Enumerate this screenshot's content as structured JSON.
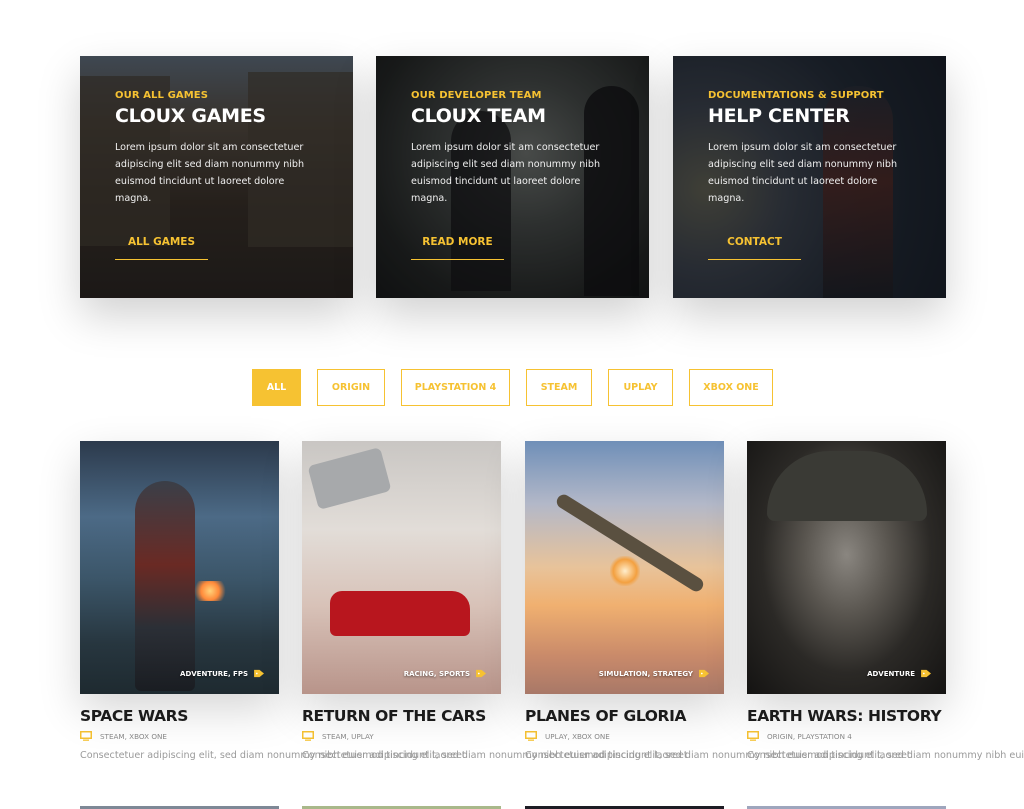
{
  "accent_color": "#f6c232",
  "features": [
    {
      "eyebrow": "OUR ALL GAMES",
      "title": "CLOUX GAMES",
      "description": "Lorem ipsum dolor sit am consectetuer adipiscing elit sed diam nonummy nibh euismod tincidunt ut laoreet dolore magna.",
      "cta": "ALL GAMES"
    },
    {
      "eyebrow": "OUR DEVELOPER TEAM",
      "title": "CLOUX TEAM",
      "description": "Lorem ipsum dolor sit am consectetuer adipiscing elit sed diam nonummy nibh euismod tincidunt ut laoreet dolore magna.",
      "cta": "READ MORE"
    },
    {
      "eyebrow": "DOCUMENTATIONS & SUPPORT",
      "title": "HELP CENTER",
      "description": "Lorem ipsum dolor sit am consectetuer adipiscing elit sed diam nonummy nibh euismod tincidunt ut laoreet dolore magna.",
      "cta": "CONTACT"
    }
  ],
  "filters": {
    "active": "ALL",
    "items": [
      "ALL",
      "ORIGIN",
      "PLAYSTATION 4",
      "STEAM",
      "UPLAY",
      "XBOX ONE"
    ]
  },
  "games": [
    {
      "title": "SPACE WARS",
      "genres": "ADVENTURE, FPS",
      "platforms": "STEAM, XBOX ONE",
      "description": "Consectetuer adipiscing elit, sed diam nonummy nibh euismod tincidunt laoreet"
    },
    {
      "title": "RETURN OF THE CARS",
      "genres": "RACING, SPORTS",
      "platforms": "STEAM, UPLAY",
      "description": "Consectetuer adipiscing elit, sed diam nonummy nibh euismod tincidunt laoreet"
    },
    {
      "title": "PLANES OF GLORIA",
      "genres": "SIMULATION, STRATEGY",
      "platforms": "UPLAY, XBOX ONE",
      "description": "Consectetuer adipiscing elit, sed diam nonummy nibh euismod tincidunt laoreet"
    },
    {
      "title": "EARTH WARS: HISTORY",
      "genres": "ADVENTURE",
      "platforms": "ORIGIN, PLAYSTATION 4",
      "description": "Consectetuer adipiscing elit, sed diam nonummy nibh euismod tincidunt laoreet"
    }
  ]
}
